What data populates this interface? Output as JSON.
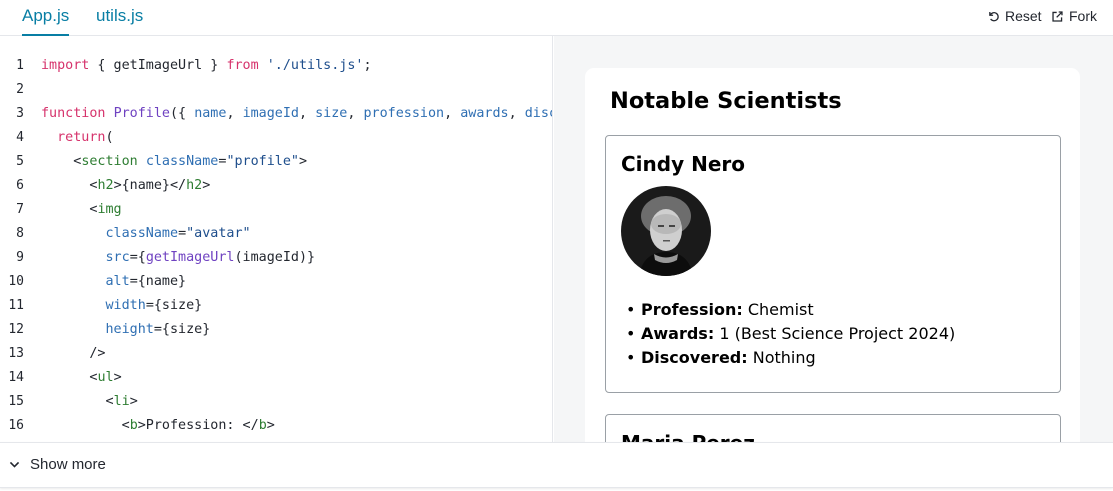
{
  "tabs": [
    {
      "label": "App.js",
      "active": true
    },
    {
      "label": "utils.js",
      "active": false
    }
  ],
  "toolbar": {
    "reset_label": "Reset",
    "fork_label": "Fork",
    "reset_icon": "reset-icon",
    "fork_icon": "external-link-icon"
  },
  "editor": {
    "line_numbers": [
      "1",
      "2",
      "3",
      "4",
      "5",
      "6",
      "7",
      "8",
      "9",
      "10",
      "11",
      "12",
      "13",
      "14",
      "15",
      "16"
    ],
    "lines": [
      [
        [
          "kw",
          "import"
        ],
        [
          "punc",
          " { getImageUrl } "
        ],
        [
          "kw",
          "from"
        ],
        [
          "punc",
          " "
        ],
        [
          "str",
          "'./utils.js'"
        ],
        [
          "punc",
          ";"
        ]
      ],
      [],
      [
        [
          "kw",
          "function"
        ],
        [
          "punc",
          " "
        ],
        [
          "fn",
          "Profile"
        ],
        [
          "punc",
          "({ "
        ],
        [
          "attr",
          "name"
        ],
        [
          "punc",
          ", "
        ],
        [
          "attr",
          "imageId"
        ],
        [
          "punc",
          ", "
        ],
        [
          "attr",
          "size"
        ],
        [
          "punc",
          ", "
        ],
        [
          "attr",
          "profession"
        ],
        [
          "punc",
          ", "
        ],
        [
          "attr",
          "awards"
        ],
        [
          "punc",
          ", "
        ],
        [
          "attr",
          "discovered"
        ],
        [
          "punc",
          " }) {"
        ]
      ],
      [
        [
          "punc",
          "  "
        ],
        [
          "kw",
          "return"
        ],
        [
          "punc",
          "("
        ]
      ],
      [
        [
          "punc",
          "    <"
        ],
        [
          "tag",
          "section"
        ],
        [
          "punc",
          " "
        ],
        [
          "attr",
          "className"
        ],
        [
          "punc",
          "="
        ],
        [
          "str",
          "\"profile\""
        ],
        [
          "punc",
          ">"
        ]
      ],
      [
        [
          "punc",
          "      <"
        ],
        [
          "tag",
          "h2"
        ],
        [
          "punc",
          ">{name}</"
        ],
        [
          "tag",
          "h2"
        ],
        [
          "punc",
          ">"
        ]
      ],
      [
        [
          "punc",
          "      <"
        ],
        [
          "tag",
          "img"
        ]
      ],
      [
        [
          "punc",
          "        "
        ],
        [
          "attr",
          "className"
        ],
        [
          "punc",
          "="
        ],
        [
          "str",
          "\"avatar\""
        ]
      ],
      [
        [
          "punc",
          "        "
        ],
        [
          "attr",
          "src"
        ],
        [
          "punc",
          "={"
        ],
        [
          "fn",
          "getImageUrl"
        ],
        [
          "punc",
          "(imageId)}"
        ]
      ],
      [
        [
          "punc",
          "        "
        ],
        [
          "attr",
          "alt"
        ],
        [
          "punc",
          "={name}"
        ]
      ],
      [
        [
          "punc",
          "        "
        ],
        [
          "attr",
          "width"
        ],
        [
          "punc",
          "={size}"
        ]
      ],
      [
        [
          "punc",
          "        "
        ],
        [
          "attr",
          "height"
        ],
        [
          "punc",
          "={size}"
        ]
      ],
      [
        [
          "punc",
          "      />"
        ]
      ],
      [
        [
          "punc",
          "      <"
        ],
        [
          "tag",
          "ul"
        ],
        [
          "punc",
          ">"
        ]
      ],
      [
        [
          "punc",
          "        <"
        ],
        [
          "tag",
          "li"
        ],
        [
          "punc",
          ">"
        ]
      ],
      [
        [
          "punc",
          "          <"
        ],
        [
          "tag",
          "b"
        ],
        [
          "punc",
          ">Profession: </"
        ],
        [
          "tag",
          "b"
        ],
        [
          "punc",
          ">"
        ]
      ]
    ]
  },
  "preview": {
    "title": "Notable Scientists",
    "profiles": [
      {
        "name": "Cindy Nero",
        "facts": [
          {
            "label": "Profession:",
            "value": " Chemist"
          },
          {
            "label": "Awards:",
            "value": " 1 (Best Science Project 2024)"
          },
          {
            "label": "Discovered:",
            "value": " Nothing"
          }
        ]
      },
      {
        "name": "Maria Perez"
      }
    ]
  },
  "footer": {
    "show_more_label": "Show more",
    "icon": "chevron-down-icon"
  }
}
